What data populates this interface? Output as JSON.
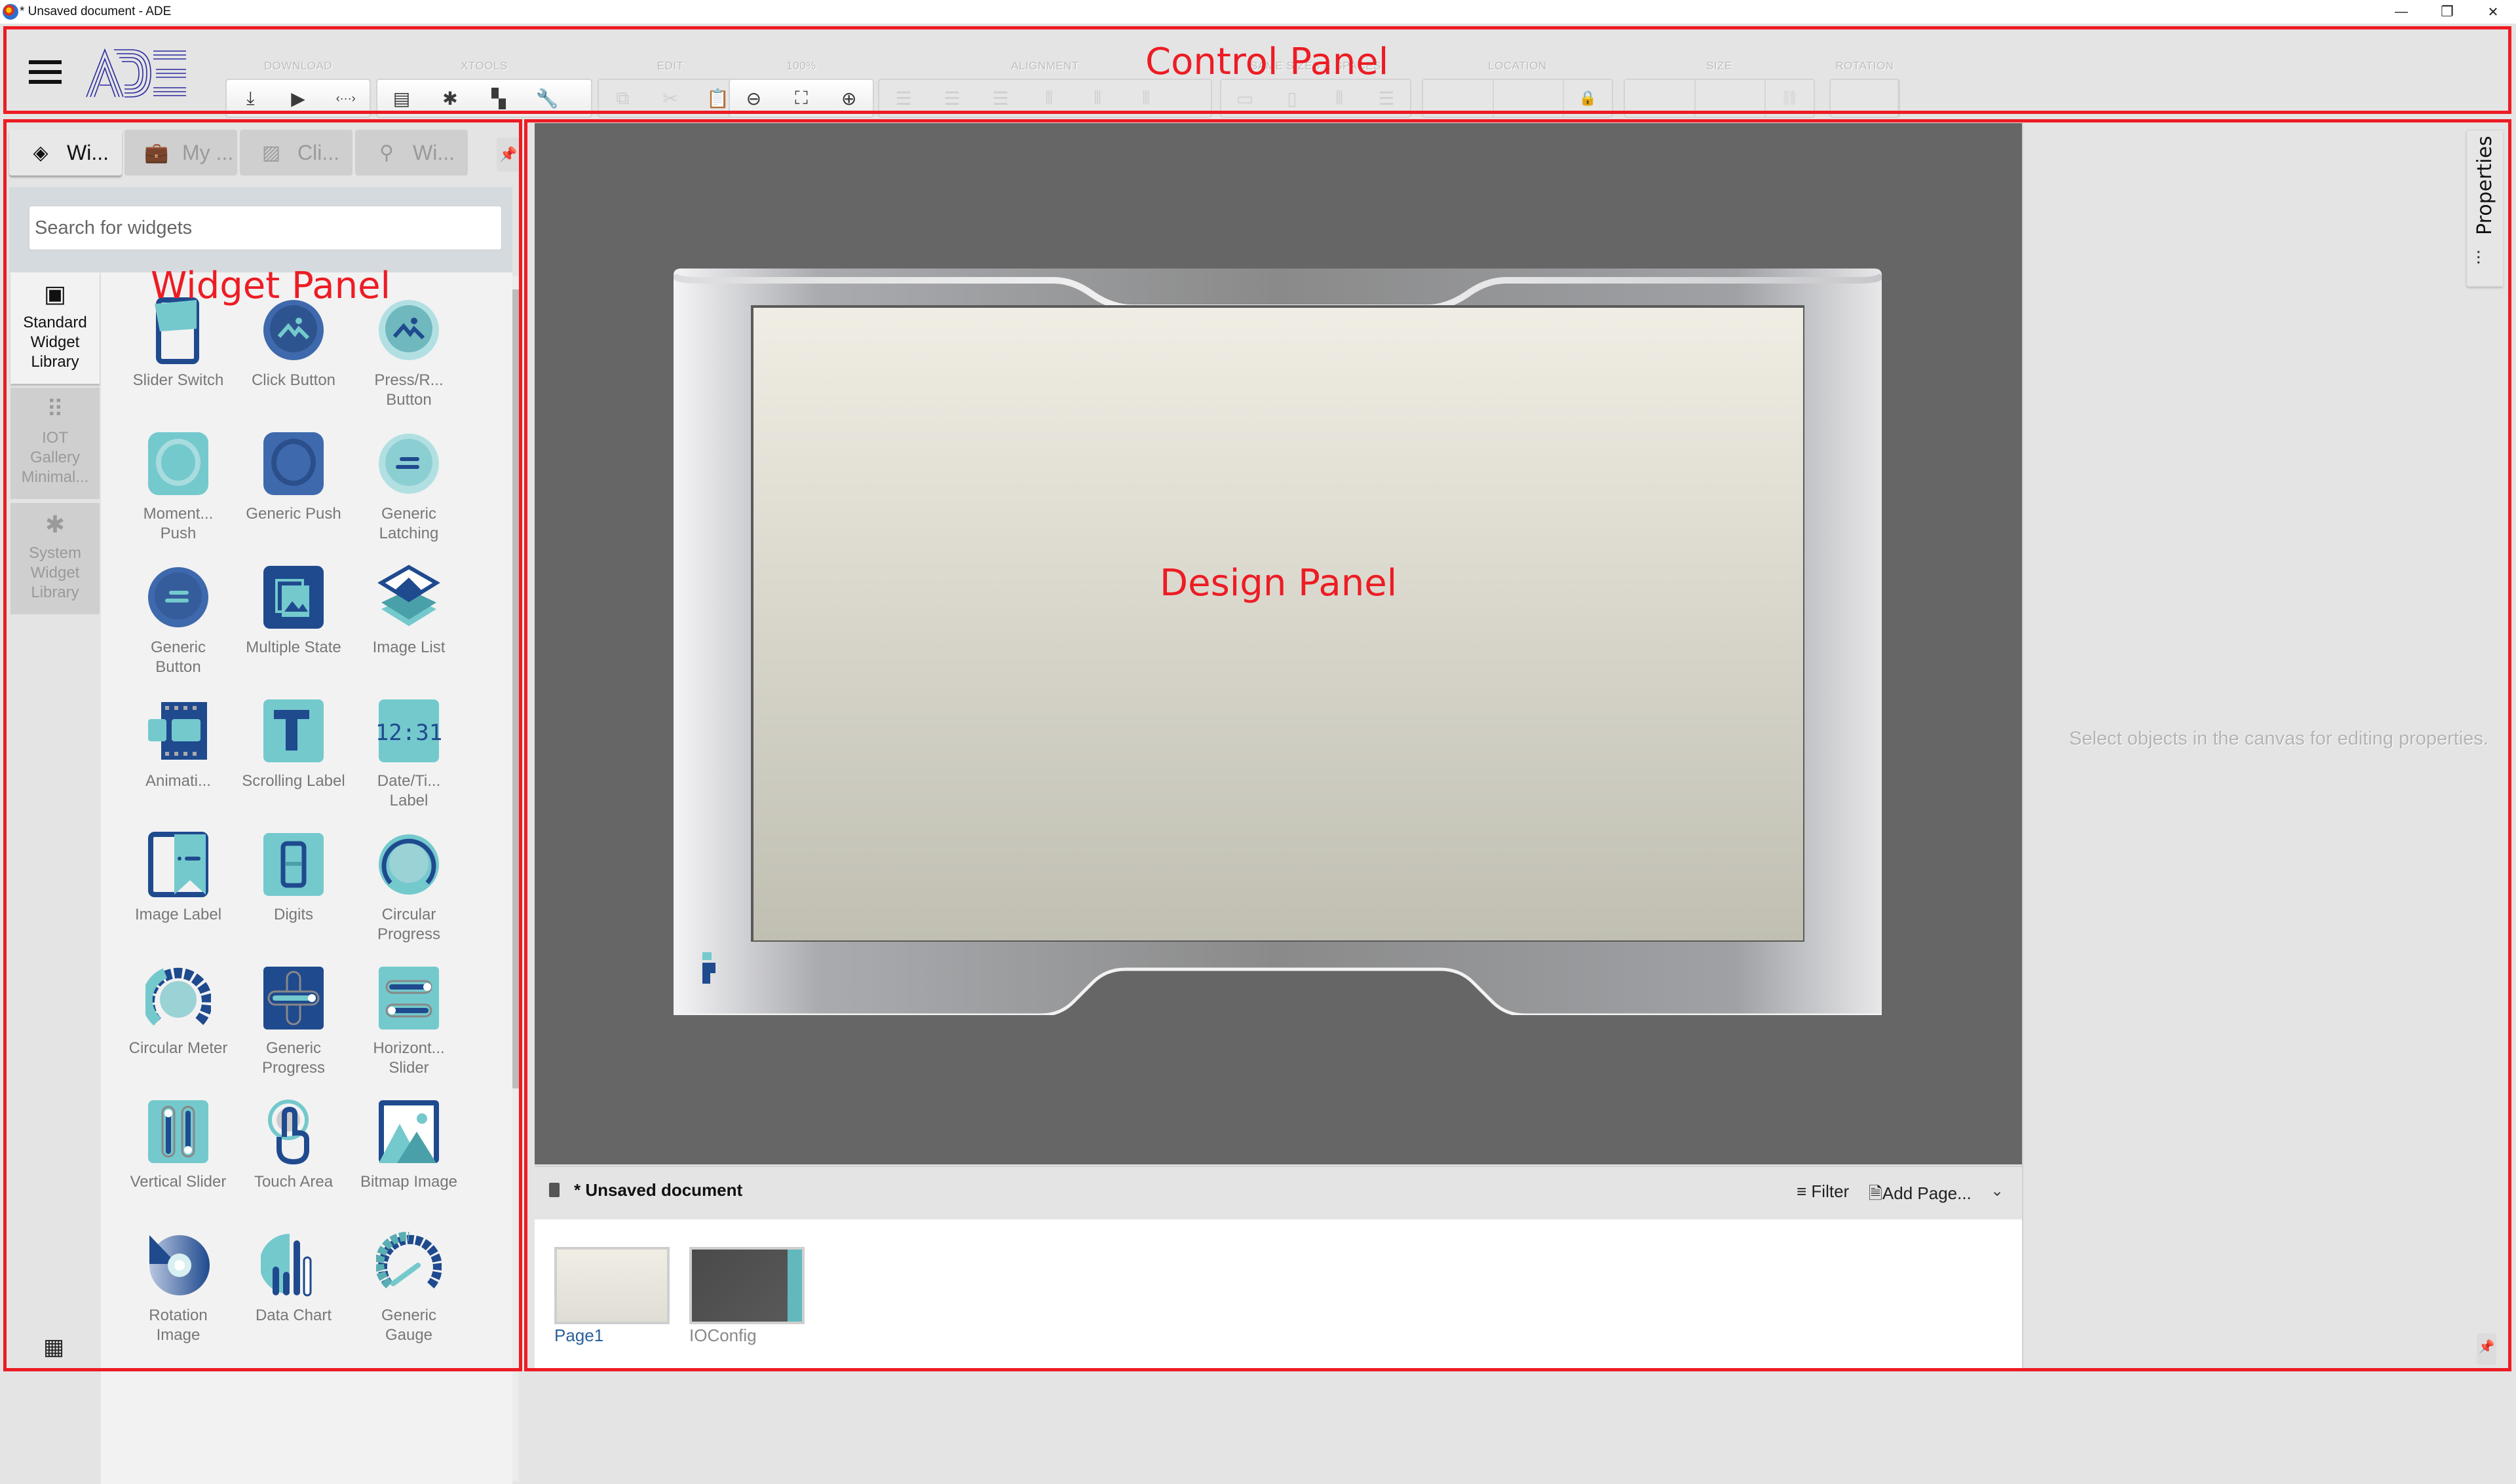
{
  "window": {
    "title": "* Unsaved document - ADE",
    "minimize_label": "—",
    "restore_label": "❐",
    "close_label": "✕"
  },
  "annotations": {
    "control_panel": "Control Panel",
    "widget_panel": "Widget Panel",
    "design_panel": "Design Panel",
    "color": "#ed1c24"
  },
  "toolbar": {
    "logo_text": "ADE",
    "groups": [
      {
        "label": "DOWNLOAD",
        "buttons": [
          {
            "name": "download-icon",
            "glyph": "⤓",
            "enabled": true
          },
          {
            "name": "preview-icon",
            "glyph": "▶",
            "enabled": true
          },
          {
            "name": "code-icon",
            "glyph": "‹···›",
            "enabled": true
          }
        ]
      },
      {
        "label": "XTOOLS",
        "buttons": [
          {
            "name": "server-icon",
            "glyph": "▤",
            "enabled": true
          },
          {
            "name": "puzzle-icon",
            "glyph": "✱",
            "enabled": true
          },
          {
            "name": "widgets-icon",
            "glyph": "▚",
            "enabled": true
          },
          {
            "name": "wrench-icon",
            "glyph": "🔧",
            "enabled": false
          }
        ]
      },
      {
        "label": "EDIT",
        "buttons": [
          {
            "name": "copy-icon",
            "glyph": "⧉",
            "enabled": false
          },
          {
            "name": "cut-icon",
            "glyph": "✂",
            "enabled": false
          },
          {
            "name": "paste-icon",
            "glyph": "📋",
            "enabled": false
          }
        ]
      },
      {
        "label": "100%",
        "buttons": [
          {
            "name": "zoom-out-icon",
            "glyph": "⊖",
            "enabled": true
          },
          {
            "name": "fit-screen-icon",
            "glyph": "⛶",
            "enabled": true
          },
          {
            "name": "zoom-in-icon",
            "glyph": "⊕",
            "enabled": true
          }
        ]
      },
      {
        "label": "ALIGNMENT",
        "buttons": [
          {
            "name": "align-left-icon",
            "glyph": "☰",
            "enabled": false
          },
          {
            "name": "align-center-icon",
            "glyph": "☰",
            "enabled": false
          },
          {
            "name": "align-right-icon",
            "glyph": "☰",
            "enabled": false
          },
          {
            "name": "align-top-icon",
            "glyph": "⦀",
            "enabled": false
          },
          {
            "name": "align-middle-icon",
            "glyph": "⦀",
            "enabled": false
          },
          {
            "name": "align-bottom-icon",
            "glyph": "⦀",
            "enabled": false
          }
        ]
      },
      {
        "label": "SAME SIZES & SPACES",
        "buttons": [
          {
            "name": "same-width-icon",
            "glyph": "▭",
            "enabled": false
          },
          {
            "name": "same-height-icon",
            "glyph": "▯",
            "enabled": false
          },
          {
            "name": "space-horizontal-icon",
            "glyph": "⦀",
            "enabled": false
          },
          {
            "name": "space-vertical-icon",
            "glyph": "☰",
            "enabled": false
          }
        ]
      },
      {
        "label": "LOCATION",
        "fields": [
          "",
          ""
        ],
        "trailing_icon": "lock-icon"
      },
      {
        "label": "SIZE",
        "fields": [
          "",
          ""
        ],
        "trailing_icon": "link-icon"
      },
      {
        "label": "ROTATION",
        "fields": [
          ""
        ]
      }
    ]
  },
  "widget_panel": {
    "tabs": [
      {
        "label": "Wi...",
        "icon": "layers-icon",
        "active": true
      },
      {
        "label": "My ...",
        "icon": "briefcase-icon",
        "active": false
      },
      {
        "label": "Cli...",
        "icon": "image-icon",
        "active": false
      },
      {
        "label": "Wi...",
        "icon": "location-pin-icon",
        "active": false
      }
    ],
    "search_placeholder": "Search for widgets",
    "search_value": "",
    "libraries": [
      {
        "label": "Standard Widget Library",
        "icon": "widget-library-icon",
        "active": true
      },
      {
        "label": "IOT Gallery Minimal...",
        "icon": "grid-dots-icon",
        "active": false
      },
      {
        "label": "System Widget Library",
        "icon": "puzzle-icon",
        "active": false
      }
    ],
    "widgets": [
      {
        "label": "Slider Switch",
        "icon": "slider-switch-icon"
      },
      {
        "label": "Click Button",
        "icon": "click-button-icon"
      },
      {
        "label": "Press/R... Button",
        "icon": "press-release-button-icon"
      },
      {
        "label": "Moment... Push",
        "icon": "momentary-push-icon"
      },
      {
        "label": "Generic Push",
        "icon": "generic-push-icon"
      },
      {
        "label": "Generic Latching",
        "icon": "generic-latching-icon"
      },
      {
        "label": "Generic Button",
        "icon": "generic-button-icon"
      },
      {
        "label": "Multiple State",
        "icon": "multiple-state-icon"
      },
      {
        "label": "Image List",
        "icon": "image-list-icon"
      },
      {
        "label": "Animati...",
        "icon": "animation-icon"
      },
      {
        "label": "Scrolling Label",
        "icon": "scrolling-label-icon"
      },
      {
        "label": "Date/Ti... Label",
        "icon": "datetime-label-icon"
      },
      {
        "label": "Image Label",
        "icon": "image-label-icon"
      },
      {
        "label": "Digits",
        "icon": "digits-icon"
      },
      {
        "label": "Circular Progress",
        "icon": "circular-progress-icon"
      },
      {
        "label": "Circular Meter",
        "icon": "circular-meter-icon"
      },
      {
        "label": "Generic Progress",
        "icon": "generic-progress-icon"
      },
      {
        "label": "Horizont... Slider",
        "icon": "horizontal-slider-icon"
      },
      {
        "label": "Vertical Slider",
        "icon": "vertical-slider-icon"
      },
      {
        "label": "Touch Area",
        "icon": "touch-area-icon"
      },
      {
        "label": "Bitmap Image",
        "icon": "bitmap-image-icon"
      },
      {
        "label": "Rotation Image",
        "icon": "rotation-image-icon"
      },
      {
        "label": "Data Chart",
        "icon": "data-chart-icon"
      },
      {
        "label": "Generic Gauge",
        "icon": "generic-gauge-icon"
      }
    ]
  },
  "design_panel": {
    "document_title": "* Unsaved document",
    "filter_label": "Filter",
    "add_page_label": "Add Page...",
    "pages": [
      {
        "label": "Page1",
        "selected": true
      },
      {
        "label": "IOConfig",
        "selected": false
      }
    ]
  },
  "properties_panel": {
    "tab_label": "Properties",
    "empty_message": "Select objects in the canvas for editing properties."
  }
}
